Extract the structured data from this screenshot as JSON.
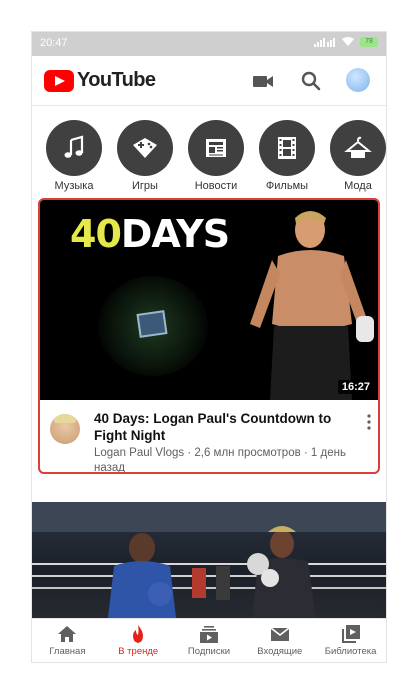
{
  "status_bar": {
    "time": "20:47",
    "battery": "78"
  },
  "app_bar": {
    "logo_text": "YouTube",
    "icons": [
      "camera-icon",
      "search-icon",
      "account-avatar"
    ]
  },
  "categories": [
    {
      "label": "Музыка",
      "icon": "music-note-icon"
    },
    {
      "label": "Игры",
      "icon": "gamepad-icon"
    },
    {
      "label": "Новости",
      "icon": "newspaper-icon"
    },
    {
      "label": "Фильмы",
      "icon": "film-icon"
    },
    {
      "label": "Мода",
      "icon": "hanger-icon"
    }
  ],
  "videos": [
    {
      "thumbnail_text_number": "40",
      "thumbnail_text_word": "DAYS",
      "duration": "16:27",
      "title": "40 Days: Logan Paul's Countdown to Fight Night",
      "channel_line": "Logan Paul Vlogs · 2,6 млн просмотров · 1 день назад"
    }
  ],
  "bottom_nav": [
    {
      "label": "Главная",
      "icon": "home-icon",
      "active": false
    },
    {
      "label": "В тренде",
      "icon": "flame-icon",
      "active": true
    },
    {
      "label": "Подписки",
      "icon": "subscriptions-icon",
      "active": false
    },
    {
      "label": "Входящие",
      "icon": "mail-icon",
      "active": false
    },
    {
      "label": "Библиотека",
      "icon": "library-icon",
      "active": false
    }
  ],
  "colors": {
    "accent": "#ff0000",
    "active_nav": "#e62117",
    "category_circle": "#404040",
    "highlight_border": "#d8403a"
  }
}
